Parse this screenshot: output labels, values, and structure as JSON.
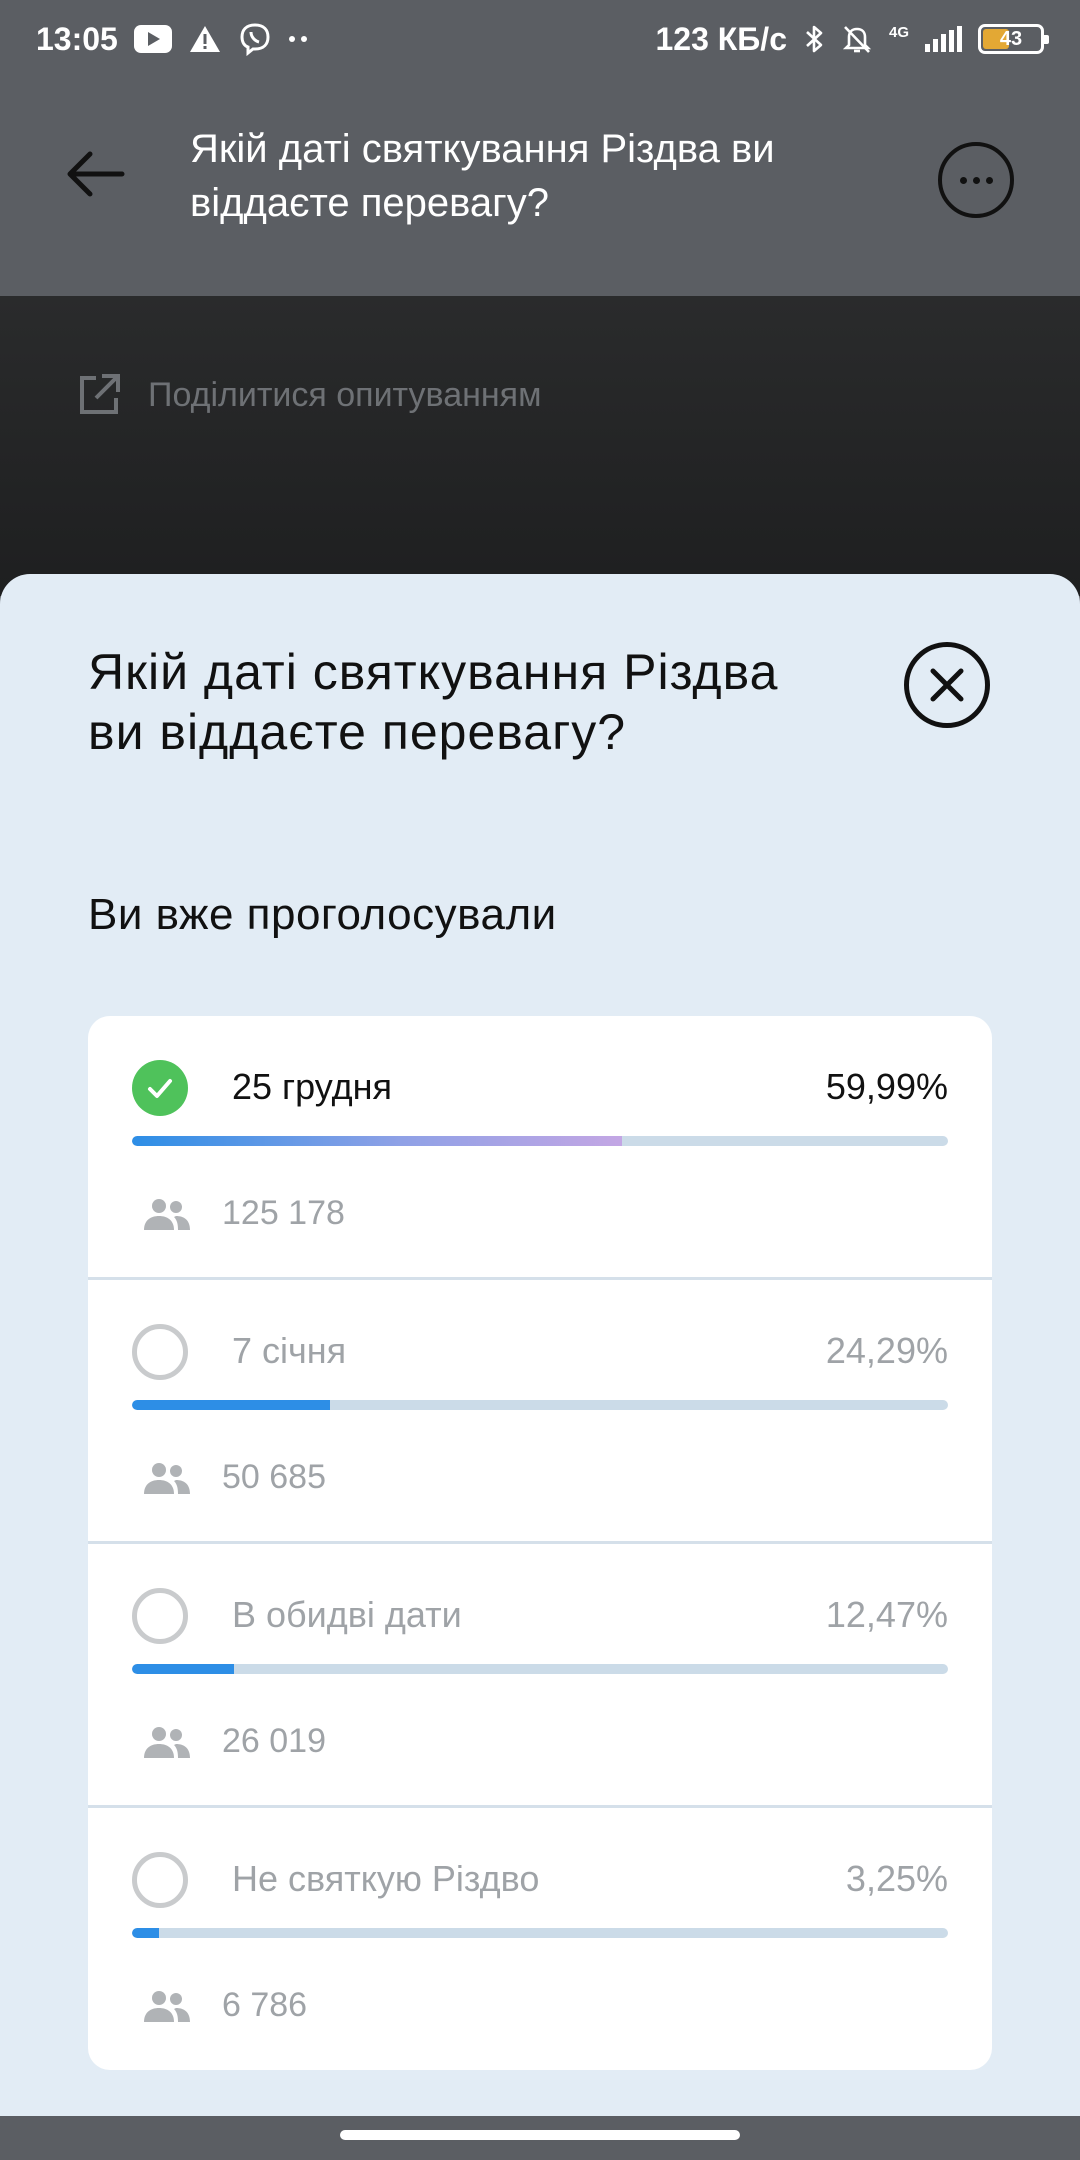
{
  "status_bar": {
    "time": "13:05",
    "speed": "123 КБ/с",
    "network": "4G",
    "battery": "43",
    "icons": [
      "youtube-icon",
      "warning-icon",
      "viber-icon",
      "more-dots-icon",
      "bluetooth-icon",
      "bell-off-icon",
      "signal-icon",
      "battery-icon"
    ]
  },
  "app_bar": {
    "title": "Якій даті святкування Різдва ви віддаєте перевагу?"
  },
  "background": {
    "share_label": "Поділитися опитуванням"
  },
  "sheet": {
    "title": "Якій даті святкування Різдва ви віддаєте перевагу?",
    "voted_label": "Ви вже проголосували"
  },
  "options": [
    {
      "label": "25 грудня",
      "percent": "59,99%",
      "votes": "125 178",
      "fraction": 0.5999,
      "selected": true
    },
    {
      "label": "7 січня",
      "percent": "24,29%",
      "votes": "50 685",
      "fraction": 0.2429,
      "selected": false
    },
    {
      "label": "В обидві дати",
      "percent": "12,47%",
      "votes": "26 019",
      "fraction": 0.1247,
      "selected": false
    },
    {
      "label": "Не святкую Різдво",
      "percent": "3,25%",
      "votes": "6 786",
      "fraction": 0.0325,
      "selected": false
    }
  ],
  "colors": {
    "accent": "#2d8ee6",
    "check": "#4fc25b",
    "sheet_bg": "#e2ecf5",
    "overlay": "#5b5e63"
  }
}
